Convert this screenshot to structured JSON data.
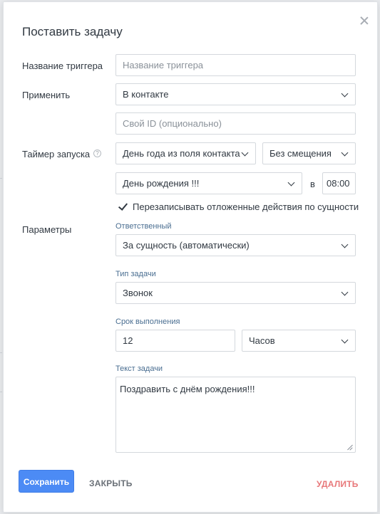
{
  "dialog": {
    "title": "Поставить задачу"
  },
  "trigger_name": {
    "label": "Название триггера",
    "placeholder": "Название триггера"
  },
  "apply": {
    "label": "Применить",
    "selected": "В контакте"
  },
  "custom_id": {
    "placeholder": "Свой ID (опционально)"
  },
  "timer": {
    "label": "Таймер запуска",
    "help_symbol": "?",
    "source_selected": "День года из поля контакта",
    "offset_selected": "Без смещения",
    "field_selected": "День рождения !!!",
    "at_label": "в",
    "time_value": "08:00"
  },
  "overwrite": {
    "label": "Перезаписывать отложенные действия по сущности",
    "checked": true
  },
  "params": {
    "label": "Параметры",
    "responsible": {
      "label": "Ответственный",
      "selected": "За сущность (автоматически)"
    },
    "task_type": {
      "label": "Тип задачи",
      "selected": "Звонок"
    },
    "deadline": {
      "label": "Срок выполнения",
      "value": "12",
      "unit_selected": "Часов"
    },
    "task_text": {
      "label": "Текст задачи",
      "value": "Поздравить с днём рождения!!!"
    }
  },
  "footer": {
    "save_label": "Сохранить",
    "close_label": "ЗАКРЫТЬ",
    "delete_label": "УДАЛИТЬ"
  },
  "colors": {
    "primary": "#4c8bf5",
    "danger": "#e8787a",
    "label_blue": "#4a6e91"
  },
  "icons": {
    "close": "close-icon",
    "help": "help-icon",
    "chevron": "chevron-down-icon",
    "check": "check-icon"
  }
}
